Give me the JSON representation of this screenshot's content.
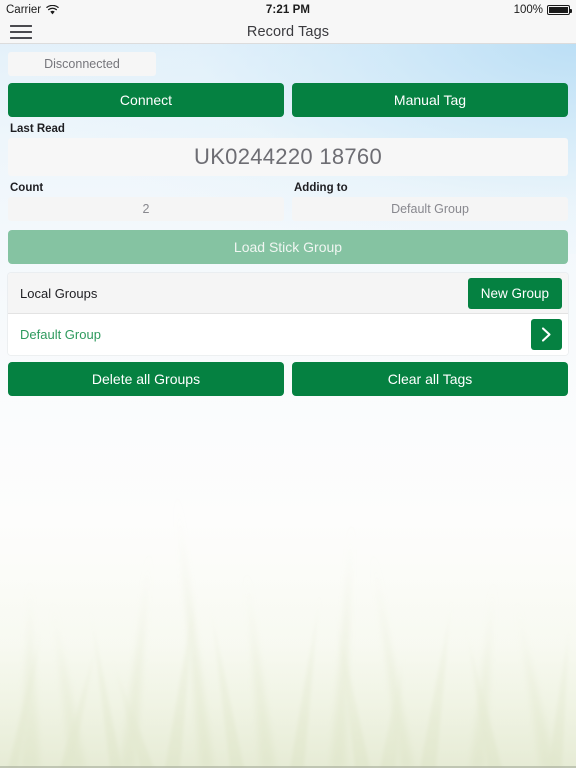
{
  "status_bar": {
    "carrier": "Carrier",
    "wifi_icon": "wifi-icon",
    "time": "7:21 PM",
    "battery_percent": "100%",
    "battery_level": 100,
    "battery_icon": "battery-full-icon"
  },
  "nav": {
    "menu_icon": "hamburger-menu-icon",
    "title": "Record Tags"
  },
  "connection": {
    "status": "Disconnected",
    "connect_label": "Connect",
    "manual_tag_label": "Manual Tag"
  },
  "last_read": {
    "label": "Last Read",
    "value": "UK0244220 18760"
  },
  "count": {
    "label": "Count",
    "value": "2"
  },
  "adding_to": {
    "label": "Adding to",
    "value": "Default Group"
  },
  "load_stick": {
    "label": "Load Stick Group",
    "disabled": true
  },
  "local_groups": {
    "header": "Local Groups",
    "new_group_label": "New Group",
    "rows": [
      {
        "label": "Default Group",
        "chevron_icon": "chevron-right-icon"
      }
    ]
  },
  "footer_actions": {
    "delete_all_label": "Delete all Groups",
    "clear_tags_label": "Clear all Tags"
  },
  "colors": {
    "brand_green": "#058141",
    "brand_green_disabled": "#85c3a2",
    "link_green": "#2e9a5e",
    "field_grey": "#f5f5f5",
    "nav_grey": "#f7f7f7"
  }
}
